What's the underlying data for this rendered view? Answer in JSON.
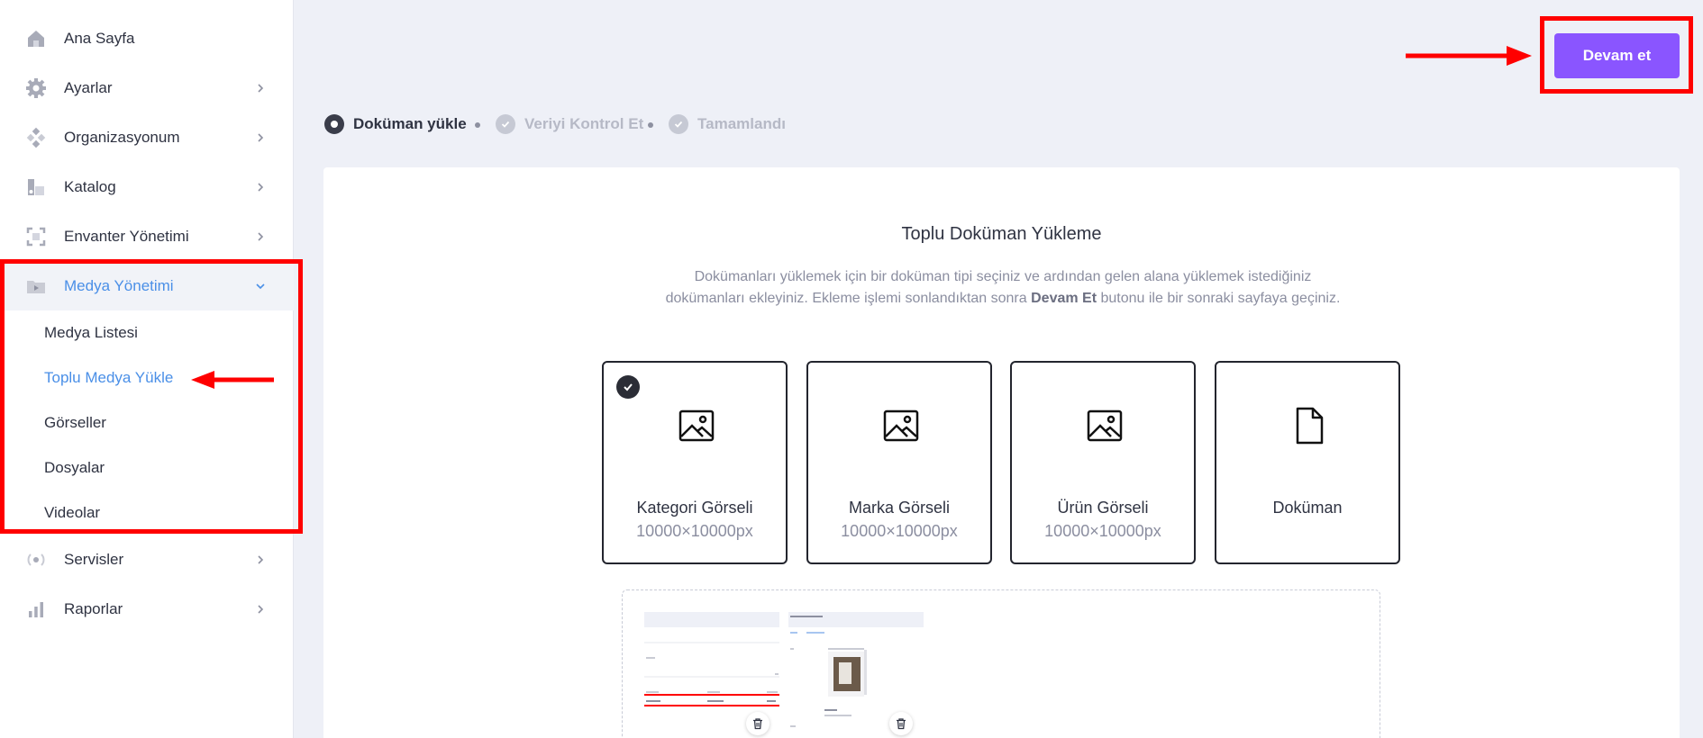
{
  "sidebar": {
    "items": [
      {
        "label": "Ana Sayfa",
        "icon": "home-icon"
      },
      {
        "label": "Ayarlar",
        "icon": "gear-icon"
      },
      {
        "label": "Organizasyonum",
        "icon": "organization-icon"
      },
      {
        "label": "Katalog",
        "icon": "catalog-icon"
      },
      {
        "label": "Envanter Yönetimi",
        "icon": "inventory-icon"
      },
      {
        "label": "Medya Yönetimi",
        "icon": "media-icon"
      },
      {
        "label": "Servisler",
        "icon": "services-icon"
      },
      {
        "label": "Raporlar",
        "icon": "reports-icon"
      }
    ],
    "media_submenu": [
      "Medya Listesi",
      "Toplu Medya Yükle",
      "Görseller",
      "Dosyalar",
      "Videolar"
    ]
  },
  "header": {
    "continue_button": "Devam et"
  },
  "stepper": {
    "steps": [
      "Doküman yükle",
      "Veriyi Kontrol Et",
      "Tamamlandı"
    ],
    "active_index": 0
  },
  "main": {
    "title": "Toplu Doküman Yükleme",
    "desc_part1": "Dokümanları yüklemek için bir doküman tipi seçiniz ve ardından gelen alana yüklemek istediğiniz dokümanları ekleyiniz. Ekleme işlemi sonlandıktan sonra ",
    "desc_bold": "Devam Et",
    "desc_part2": " butonu ile bir sonraki sayfaya geçiniz.",
    "doc_types": [
      {
        "name": "Kategori Görseli",
        "size": "10000×10000px",
        "icon": "image-icon",
        "selected": true
      },
      {
        "name": "Marka Görseli",
        "size": "10000×10000px",
        "icon": "image-icon",
        "selected": false
      },
      {
        "name": "Ürün Görseli",
        "size": "10000×10000px",
        "icon": "image-icon",
        "selected": false
      },
      {
        "name": "Doküman",
        "size": "",
        "icon": "document-icon",
        "selected": false
      }
    ]
  },
  "colors": {
    "accent": "#8a55ff",
    "link": "#4a8fe7",
    "highlight": "#ff0000",
    "background": "#eef0f7"
  }
}
